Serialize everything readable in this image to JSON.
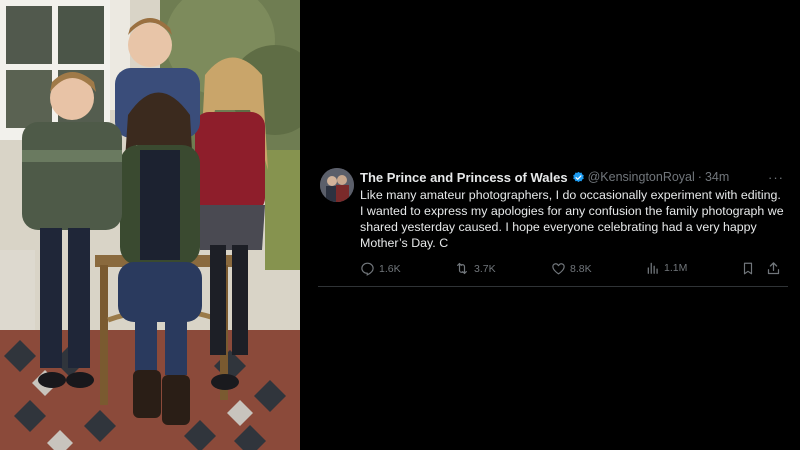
{
  "tweet": {
    "display_name": "The Prince and Princess of Wales",
    "handle": "@KensingtonRoyal",
    "separator": "·",
    "time": "34m",
    "more": "···",
    "text": "Like many amateur photographers, I do occasionally experiment with editing. I wanted to express my apologies for any confusion the family photograph we shared yesterday caused. I hope everyone celebrating had a very happy Mother’s Day. C"
  },
  "actions": {
    "replies": "1.6K",
    "reposts": "3.7K",
    "likes": "8.8K",
    "views": "1.1M"
  },
  "icons": {
    "verified": "verified-badge-icon",
    "reply": "reply-icon",
    "repost": "repost-icon",
    "like": "heart-icon",
    "views": "views-chart-icon",
    "bookmark": "bookmark-icon",
    "share": "share-icon",
    "more": "more-dots-icon"
  },
  "colors": {
    "background": "#000000",
    "text_primary": "#e7e9ea",
    "text_secondary": "#71767b",
    "verified_blue": "#1d9bf0",
    "divider": "#2f3336"
  }
}
